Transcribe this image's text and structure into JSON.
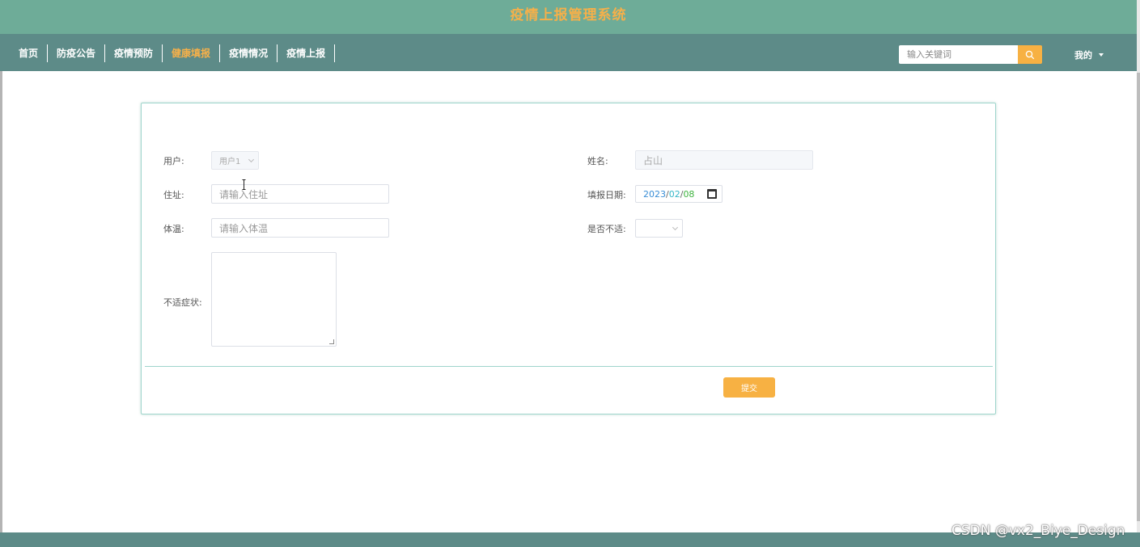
{
  "header": {
    "title": "疫情上报管理系统"
  },
  "nav": {
    "items": [
      {
        "label": "首页",
        "active": false
      },
      {
        "label": "防疫公告",
        "active": false
      },
      {
        "label": "疫情预防",
        "active": false
      },
      {
        "label": "健康填报",
        "active": true
      },
      {
        "label": "疫情情况",
        "active": false
      },
      {
        "label": "疫情上报",
        "active": false
      }
    ],
    "search_placeholder": "输入关键词",
    "search_icon": "search-icon",
    "user_menu_label": "我的"
  },
  "form": {
    "user_label": "用户:",
    "user_value": "用户1",
    "name_label": "姓名:",
    "name_value": "占山",
    "address_label": "住址:",
    "address_placeholder": "请输入住址",
    "date_label": "填报日期:",
    "date_year": "2023",
    "date_month": "02",
    "date_day": "08",
    "temperature_label": "体温:",
    "temperature_placeholder": "请输入体温",
    "unwell_label": "是否不适:",
    "unwell_value": "",
    "symptoms_label": "不适症状:",
    "submit_label": "提交"
  },
  "watermark": "CSDN @vx2_Biye_Design",
  "colors": {
    "accent": "#f7b143",
    "header": "#6eac98",
    "nav": "#5d8b88",
    "card_border": "#9fd5cc"
  }
}
